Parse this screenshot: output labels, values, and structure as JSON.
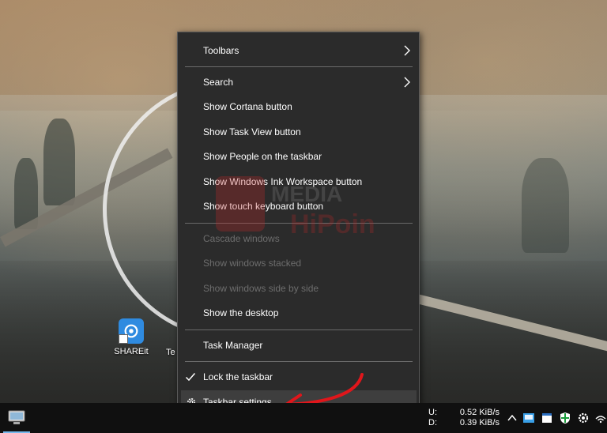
{
  "menu": {
    "items": [
      {
        "label": "Toolbars",
        "submenu": true,
        "enabled": true
      },
      {
        "label": "Search",
        "submenu": true,
        "enabled": true
      },
      {
        "label": "Show Cortana button",
        "enabled": true
      },
      {
        "label": "Show Task View button",
        "enabled": true
      },
      {
        "label": "Show People on the taskbar",
        "enabled": true
      },
      {
        "label": "Show Windows Ink Workspace button",
        "enabled": true
      },
      {
        "label": "Show touch keyboard button",
        "enabled": true
      },
      {
        "label": "Cascade windows",
        "enabled": false
      },
      {
        "label": "Show windows stacked",
        "enabled": false
      },
      {
        "label": "Show windows side by side",
        "enabled": false
      },
      {
        "label": "Show the desktop",
        "enabled": true
      },
      {
        "label": "Task Manager",
        "enabled": true
      },
      {
        "label": "Lock the taskbar",
        "enabled": true,
        "checked": true
      },
      {
        "label": "Taskbar settings",
        "enabled": true,
        "icon": "gear-icon",
        "highlighted": true
      }
    ]
  },
  "desktop": {
    "icons": [
      {
        "label": "SHAREit",
        "icon": "shareit-icon"
      },
      {
        "label": "Te"
      }
    ]
  },
  "watermark": {
    "line1": "MEDIA",
    "line2": "HiPoin"
  },
  "taskbar": {
    "network": {
      "upload_label": "U:",
      "upload_value": "0.52 KiB/s",
      "download_label": "D:",
      "download_value": "0.39 KiB/s"
    },
    "tray_icons": [
      "chevron-up-icon",
      "app-icon",
      "window-icon",
      "shield-icon",
      "gear-icon",
      "wifi-icon"
    ]
  },
  "colors": {
    "menu_bg": "#2b2b2b",
    "menu_text": "#ffffff",
    "disabled_text": "#6d6d6d",
    "highlight_bg": "#3e3e3e",
    "annotation_red": "#e0161b",
    "taskbar_bg": "#101010"
  }
}
